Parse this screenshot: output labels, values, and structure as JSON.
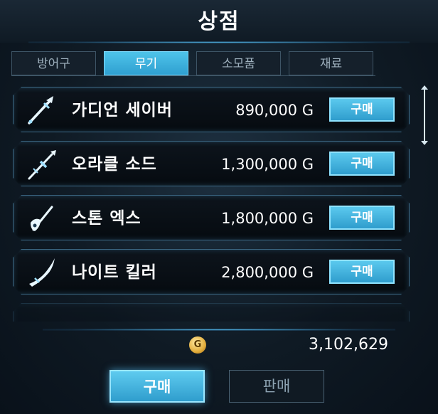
{
  "header": {
    "title": "상점"
  },
  "tabs": [
    {
      "label": "방어구",
      "active": false
    },
    {
      "label": "무기",
      "active": true
    },
    {
      "label": "소모품",
      "active": false
    },
    {
      "label": "재료",
      "active": false
    }
  ],
  "items": [
    {
      "name": "가디언 세이버",
      "price": "890,000 G",
      "buy_label": "구매",
      "icon": "saber-icon"
    },
    {
      "name": "오라클 소드",
      "price": "1,300,000 G",
      "buy_label": "구매",
      "icon": "sword-icon"
    },
    {
      "name": "스톤 엑스",
      "price": "1,800,000 G",
      "buy_label": "구매",
      "icon": "axe-icon"
    },
    {
      "name": "나이트 킬러",
      "price": "2,800,000 G",
      "buy_label": "구매",
      "icon": "blade-icon"
    }
  ],
  "gold": {
    "icon_letter": "G",
    "amount": "3,102,629"
  },
  "footer": {
    "buy_label": "구매",
    "sell_label": "판매"
  },
  "colors": {
    "accent": "#3fb4e0",
    "background": "#0f1a24"
  }
}
